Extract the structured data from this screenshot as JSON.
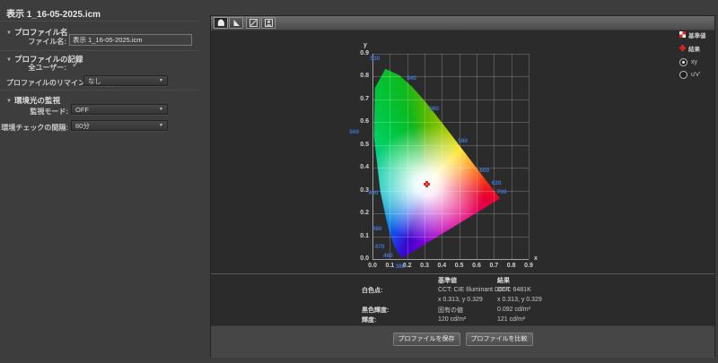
{
  "window": {
    "title": "表示 1_16-05-2025.icm"
  },
  "icons": {
    "check": "✓",
    "dropdown_arrow": "▼",
    "section_triangle": "▼"
  },
  "left_panel": {
    "profile_name": {
      "header": "プロファイル名",
      "file_label": "ファイル名:",
      "file_value": "表示 1_16-05-2025.icm"
    },
    "profile_record": {
      "header": "プロファイルの記録",
      "all_users_label": "全ユーザー:",
      "all_users_checked": true,
      "reminder_label": "プロファイルのリマインダー機能",
      "reminder_value": "なし"
    },
    "ambient_light": {
      "header": "環境光の監視",
      "mode_label": "監視モード:",
      "mode_value": "OFF",
      "interval_label": "環境チェックの間隔:",
      "interval_value": "60分"
    }
  },
  "toolbar": {
    "buttons": [
      {
        "name": "chromaticity-view",
        "active": true
      },
      {
        "name": "gamut-triangle",
        "active": false
      },
      {
        "name": "tone-curve",
        "active": false
      },
      {
        "name": "profile-info",
        "active": false
      }
    ]
  },
  "legend": {
    "reference": "基準値",
    "result": "結果",
    "radios": [
      {
        "label": "xy",
        "selected": true
      },
      {
        "label": "u'v'",
        "selected": false
      }
    ]
  },
  "chart_data": {
    "type": "scatter",
    "subtype": "CIE 1931 xy chromaticity diagram",
    "xlabel": "x",
    "ylabel": "y",
    "xlim": [
      0,
      0.9
    ],
    "ylim": [
      0,
      0.9
    ],
    "grid": true,
    "x_ticks": [
      "0.0",
      "0.1",
      "0.2",
      "0.3",
      "0.4",
      "0.5",
      "0.6",
      "0.7",
      "0.8",
      "0.9"
    ],
    "y_ticks": [
      "0.0",
      "0.1",
      "0.2",
      "0.3",
      "0.4",
      "0.5",
      "0.6",
      "0.7",
      "0.8",
      "0.9"
    ],
    "spectral_locus": [
      [
        0.1741,
        0.005
      ],
      [
        0.1566,
        0.0177
      ],
      [
        0.144,
        0.0297
      ],
      [
        0.1241,
        0.0578
      ],
      [
        0.0913,
        0.1327
      ],
      [
        0.0454,
        0.295
      ],
      [
        0.0082,
        0.5384
      ],
      [
        0.0139,
        0.7502
      ],
      [
        0.0743,
        0.8338
      ],
      [
        0.1547,
        0.8059
      ],
      [
        0.2296,
        0.7543
      ],
      [
        0.3016,
        0.6923
      ],
      [
        0.3731,
        0.6245
      ],
      [
        0.4441,
        0.5547
      ],
      [
        0.5125,
        0.4866
      ],
      [
        0.5752,
        0.4242
      ],
      [
        0.627,
        0.3725
      ],
      [
        0.6915,
        0.3083
      ],
      [
        0.7347,
        0.2653
      ]
    ],
    "wavelength_labels": [
      {
        "text": "520",
        "x": 0.015,
        "y": 0.875
      },
      {
        "text": "540",
        "x": 0.225,
        "y": 0.79
      },
      {
        "text": "560",
        "x": 0.355,
        "y": 0.655
      },
      {
        "text": "580",
        "x": 0.52,
        "y": 0.515
      },
      {
        "text": "600",
        "x": 0.645,
        "y": 0.385
      },
      {
        "text": "620",
        "x": 0.715,
        "y": 0.33
      },
      {
        "text": "700",
        "x": 0.745,
        "y": 0.29
      },
      {
        "text": "500",
        "x": -0.105,
        "y": 0.555
      },
      {
        "text": "490",
        "x": 0.005,
        "y": 0.285
      },
      {
        "text": "480",
        "x": 0.026,
        "y": 0.13
      },
      {
        "text": "470",
        "x": 0.042,
        "y": 0.052
      },
      {
        "text": "460",
        "x": 0.09,
        "y": 0.012
      },
      {
        "text": "380",
        "x": 0.16,
        "y": -0.035
      }
    ],
    "points": [
      {
        "name": "基準値",
        "x": 0.313,
        "y": 0.329
      },
      {
        "name": "結果",
        "x": 0.313,
        "y": 0.329
      }
    ],
    "white_point": {
      "x": 0.313,
      "y": 0.329
    }
  },
  "results_table": {
    "col_ref": "基準値",
    "col_res": "結果",
    "rows": [
      {
        "label": "白色点:",
        "ref": "CCT: CIE Illuminant D65K",
        "res": "CCT: 6481K"
      },
      {
        "label": "",
        "ref": "x 0.313, y 0.329",
        "res": "x 0.313, y 0.329"
      },
      {
        "label": "黒色輝度:",
        "ref": "固有の値",
        "res": "0.092 cd/m²"
      },
      {
        "label": "輝度:",
        "ref": "120 cd/m²",
        "res": "121 cd/m²"
      }
    ]
  },
  "footer": {
    "save_button": "プロファイルを保存",
    "compare_button": "プロファイルを比較"
  },
  "colors": {
    "wavelength_label": "#3f76d2",
    "marker_red": "#df2f28",
    "panel_bg": "#2b2b2b",
    "window_bg": "#3d3d3d"
  }
}
